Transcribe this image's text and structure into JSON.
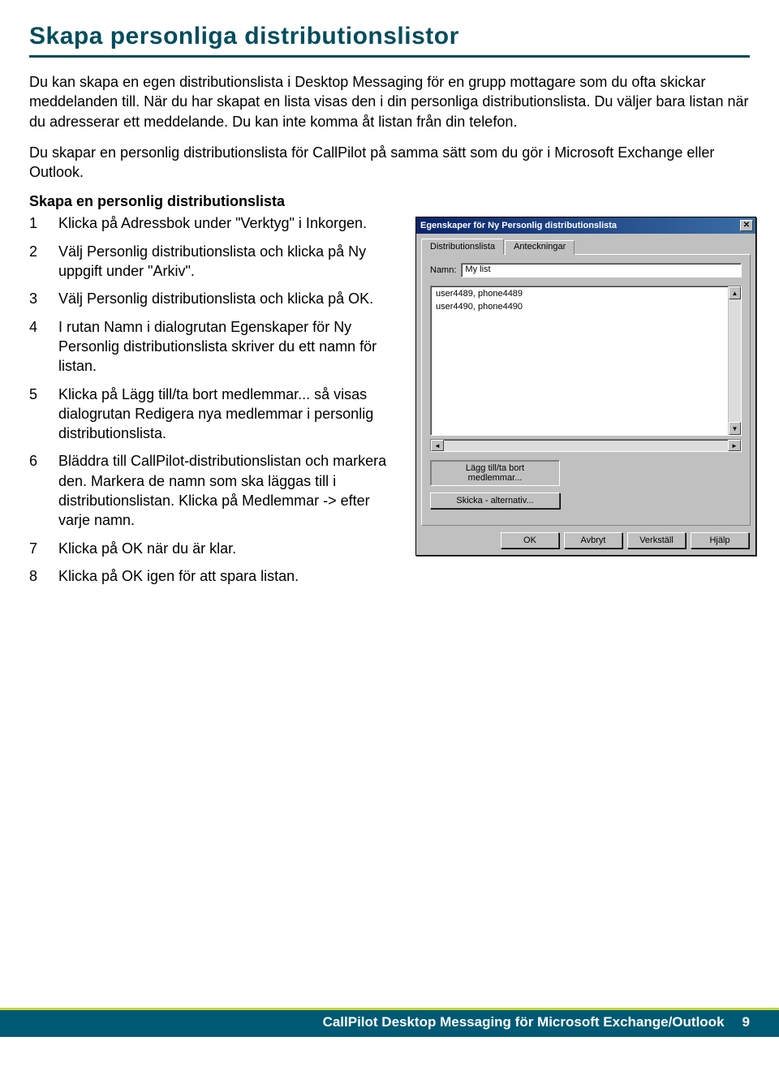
{
  "heading": "Skapa personliga distributionslistor",
  "intro": [
    "Du kan skapa en egen distributionslista i Desktop Messaging för en grupp mottagare som du ofta skickar meddelanden till. När du har skapat en lista visas den i din personliga distributionslista. Du väljer bara listan när du adresserar ett meddelande. Du kan inte komma åt listan från din telefon.",
    "Du skapar en personlig distributionslista för CallPilot på samma sätt som du gör i Microsoft Exchange eller Outlook."
  ],
  "subheading": "Skapa en personlig distributionslista",
  "steps": [
    "Klicka på Adressbok under \"Verktyg\" i Inkorgen.",
    "Välj Personlig distributionslista och klicka på Ny uppgift under \"Arkiv\".",
    "Välj Personlig distributionslista och klicka på OK.",
    "I rutan Namn i dialogrutan Egenskaper för Ny Personlig distributionslista skriver du ett namn för listan.",
    "Klicka på Lägg till/ta bort medlemmar... så visas dialogrutan Redigera nya medlemmar i personlig distributionslista.",
    "Bläddra till CallPilot-distributionslistan och markera den. Markera de namn som ska läggas till i distributionslistan. Klicka på Medlemmar -> efter varje namn.",
    "Klicka på OK när du är klar.",
    "Klicka på OK igen för att spara listan."
  ],
  "dialog": {
    "title": "Egenskaper för Ny Personlig distributionslista",
    "tabs": [
      "Distributionslista",
      "Anteckningar"
    ],
    "name_label": "Namn:",
    "name_value": "My list",
    "members": [
      "user4489, phone4489",
      "user4490, phone4490"
    ],
    "add_remove_label": "Lägg till/ta bort medlemmar...",
    "send_options_label": "Skicka - alternativ...",
    "buttons": {
      "ok": "OK",
      "cancel": "Avbryt",
      "apply": "Verkställ",
      "help": "Hjälp"
    }
  },
  "footer": {
    "text": "CallPilot Desktop Messaging för Microsoft Exchange/Outlook",
    "page": "9"
  }
}
